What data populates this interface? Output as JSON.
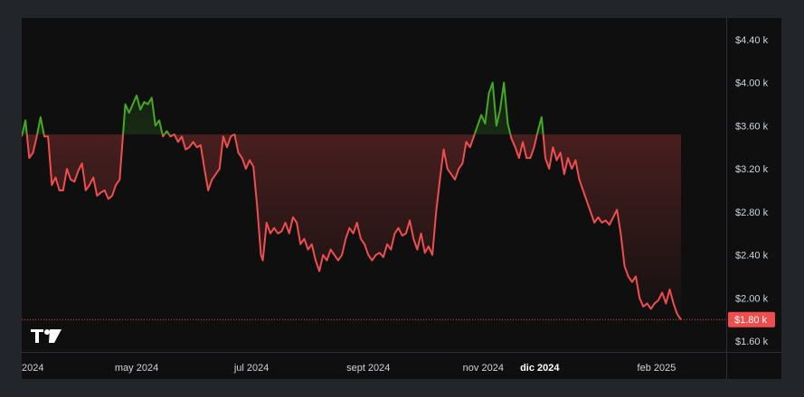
{
  "colors": {
    "background": "#0f0f0f",
    "outer": "#22262a",
    "above_baseline": "#44aa22",
    "below_baseline": "#f04e4e",
    "text": "#d1d4dc",
    "axis_line": "#2a2e39"
  },
  "logo": {
    "icon": "tradingview-logo-icon",
    "text": "TV"
  },
  "chart_data": {
    "type": "line",
    "style": "baseline",
    "y_unit": "USD",
    "ylim": [
      1.5,
      4.6
    ],
    "baseline_value": 3.52,
    "current_price": 1.8,
    "current_price_label": "$1.80 k",
    "grid": false,
    "y_ticks": [
      {
        "value": 4.4,
        "label": "$4.40 k"
      },
      {
        "value": 4.0,
        "label": "$4.00 k"
      },
      {
        "value": 3.6,
        "label": "$3.60 k"
      },
      {
        "value": 3.2,
        "label": "$3.20 k"
      },
      {
        "value": 2.8,
        "label": "$2.80 k"
      },
      {
        "value": 2.4,
        "label": "$2.40 k"
      },
      {
        "value": 2.0,
        "label": "$2.00 k"
      },
      {
        "value": 1.6,
        "label": "$1.60 k"
      }
    ],
    "x_ticks": [
      {
        "date": "2024-03-01",
        "label": "2024",
        "bold": false
      },
      {
        "date": "2024-05-01",
        "label": "may 2024",
        "bold": false
      },
      {
        "date": "2024-07-01",
        "label": "jul 2024",
        "bold": false
      },
      {
        "date": "2024-09-01",
        "label": "sept 2024",
        "bold": false
      },
      {
        "date": "2024-11-01",
        "label": "nov 2024",
        "bold": false
      },
      {
        "date": "2024-12-01",
        "label": "dic 2024",
        "bold": true
      },
      {
        "date": "2025-02-01",
        "label": "feb 2025",
        "bold": false
      }
    ],
    "x_start": "2024-03-01",
    "x_end": "2025-03-10",
    "points": [
      [
        "2024-03-01",
        3.5
      ],
      [
        "2024-03-03",
        3.65
      ],
      [
        "2024-03-05",
        3.3
      ],
      [
        "2024-03-07",
        3.35
      ],
      [
        "2024-03-09",
        3.5
      ],
      [
        "2024-03-11",
        3.68
      ],
      [
        "2024-03-13",
        3.5
      ],
      [
        "2024-03-15",
        3.5
      ],
      [
        "2024-03-17",
        3.05
      ],
      [
        "2024-03-19",
        3.12
      ],
      [
        "2024-03-21",
        3.0
      ],
      [
        "2024-03-23",
        3.0
      ],
      [
        "2024-03-25",
        3.2
      ],
      [
        "2024-03-27",
        3.1
      ],
      [
        "2024-03-29",
        3.08
      ],
      [
        "2024-03-31",
        3.18
      ],
      [
        "2024-04-02",
        3.25
      ],
      [
        "2024-04-04",
        3.0
      ],
      [
        "2024-04-06",
        3.05
      ],
      [
        "2024-04-08",
        3.12
      ],
      [
        "2024-04-10",
        2.95
      ],
      [
        "2024-04-12",
        2.98
      ],
      [
        "2024-04-14",
        3.0
      ],
      [
        "2024-04-16",
        2.92
      ],
      [
        "2024-04-18",
        2.95
      ],
      [
        "2024-04-20",
        3.05
      ],
      [
        "2024-04-22",
        3.1
      ],
      [
        "2024-04-25",
        3.8
      ],
      [
        "2024-04-27",
        3.72
      ],
      [
        "2024-04-29",
        3.8
      ],
      [
        "2024-05-01",
        3.88
      ],
      [
        "2024-05-03",
        3.75
      ],
      [
        "2024-05-05",
        3.82
      ],
      [
        "2024-05-07",
        3.8
      ],
      [
        "2024-05-09",
        3.86
      ],
      [
        "2024-05-11",
        3.6
      ],
      [
        "2024-05-13",
        3.65
      ],
      [
        "2024-05-15",
        3.5
      ],
      [
        "2024-05-17",
        3.55
      ],
      [
        "2024-05-19",
        3.5
      ],
      [
        "2024-05-21",
        3.52
      ],
      [
        "2024-05-23",
        3.45
      ],
      [
        "2024-05-25",
        3.5
      ],
      [
        "2024-05-27",
        3.38
      ],
      [
        "2024-05-29",
        3.4
      ],
      [
        "2024-05-31",
        3.45
      ],
      [
        "2024-06-02",
        3.4
      ],
      [
        "2024-06-04",
        3.42
      ],
      [
        "2024-06-06",
        3.2
      ],
      [
        "2024-06-08",
        3.0
      ],
      [
        "2024-06-10",
        3.1
      ],
      [
        "2024-06-12",
        3.15
      ],
      [
        "2024-06-14",
        3.2
      ],
      [
        "2024-06-16",
        3.5
      ],
      [
        "2024-06-18",
        3.4
      ],
      [
        "2024-06-20",
        3.5
      ],
      [
        "2024-06-22",
        3.52
      ],
      [
        "2024-06-24",
        3.35
      ],
      [
        "2024-06-26",
        3.3
      ],
      [
        "2024-06-28",
        3.2
      ],
      [
        "2024-06-30",
        3.28
      ],
      [
        "2024-07-02",
        3.22
      ],
      [
        "2024-07-04",
        2.85
      ],
      [
        "2024-07-06",
        2.4
      ],
      [
        "2024-07-07",
        2.35
      ],
      [
        "2024-07-09",
        2.7
      ],
      [
        "2024-07-11",
        2.6
      ],
      [
        "2024-07-13",
        2.65
      ],
      [
        "2024-07-15",
        2.6
      ],
      [
        "2024-07-17",
        2.62
      ],
      [
        "2024-07-19",
        2.7
      ],
      [
        "2024-07-21",
        2.6
      ],
      [
        "2024-07-23",
        2.75
      ],
      [
        "2024-07-25",
        2.7
      ],
      [
        "2024-07-27",
        2.5
      ],
      [
        "2024-07-29",
        2.55
      ],
      [
        "2024-07-31",
        2.45
      ],
      [
        "2024-08-02",
        2.5
      ],
      [
        "2024-08-04",
        2.35
      ],
      [
        "2024-08-06",
        2.25
      ],
      [
        "2024-08-08",
        2.4
      ],
      [
        "2024-08-10",
        2.35
      ],
      [
        "2024-08-12",
        2.45
      ],
      [
        "2024-08-14",
        2.4
      ],
      [
        "2024-08-16",
        2.35
      ],
      [
        "2024-08-18",
        2.4
      ],
      [
        "2024-08-20",
        2.55
      ],
      [
        "2024-08-22",
        2.65
      ],
      [
        "2024-08-24",
        2.6
      ],
      [
        "2024-08-26",
        2.7
      ],
      [
        "2024-08-28",
        2.55
      ],
      [
        "2024-08-30",
        2.5
      ],
      [
        "2024-09-01",
        2.4
      ],
      [
        "2024-09-03",
        2.35
      ],
      [
        "2024-09-05",
        2.4
      ],
      [
        "2024-09-07",
        2.42
      ],
      [
        "2024-09-09",
        2.38
      ],
      [
        "2024-09-11",
        2.5
      ],
      [
        "2024-09-13",
        2.45
      ],
      [
        "2024-09-15",
        2.6
      ],
      [
        "2024-09-17",
        2.65
      ],
      [
        "2024-09-19",
        2.58
      ],
      [
        "2024-09-21",
        2.6
      ],
      [
        "2024-09-23",
        2.72
      ],
      [
        "2024-09-25",
        2.55
      ],
      [
        "2024-09-27",
        2.45
      ],
      [
        "2024-09-29",
        2.6
      ],
      [
        "2024-10-01",
        2.42
      ],
      [
        "2024-10-03",
        2.48
      ],
      [
        "2024-10-05",
        2.4
      ],
      [
        "2024-10-07",
        2.8
      ],
      [
        "2024-10-09",
        3.1
      ],
      [
        "2024-10-11",
        3.38
      ],
      [
        "2024-10-13",
        3.2
      ],
      [
        "2024-10-15",
        3.15
      ],
      [
        "2024-10-17",
        3.1
      ],
      [
        "2024-10-19",
        3.2
      ],
      [
        "2024-10-21",
        3.25
      ],
      [
        "2024-10-23",
        3.45
      ],
      [
        "2024-10-25",
        3.4
      ],
      [
        "2024-10-27",
        3.5
      ],
      [
        "2024-10-29",
        3.6
      ],
      [
        "2024-10-31",
        3.7
      ],
      [
        "2024-11-02",
        3.62
      ],
      [
        "2024-11-04",
        3.9
      ],
      [
        "2024-11-06",
        4.0
      ],
      [
        "2024-11-08",
        3.6
      ],
      [
        "2024-11-10",
        3.75
      ],
      [
        "2024-11-12",
        4.0
      ],
      [
        "2024-11-14",
        3.62
      ],
      [
        "2024-11-16",
        3.48
      ],
      [
        "2024-11-18",
        3.4
      ],
      [
        "2024-11-20",
        3.3
      ],
      [
        "2024-11-22",
        3.45
      ],
      [
        "2024-11-24",
        3.3
      ],
      [
        "2024-11-26",
        3.3
      ],
      [
        "2024-11-28",
        3.4
      ],
      [
        "2024-11-30",
        3.55
      ],
      [
        "2024-12-02",
        3.68
      ],
      [
        "2024-12-04",
        3.3
      ],
      [
        "2024-12-06",
        3.2
      ],
      [
        "2024-12-08",
        3.4
      ],
      [
        "2024-12-10",
        3.28
      ],
      [
        "2024-12-12",
        3.35
      ],
      [
        "2024-12-14",
        3.15
      ],
      [
        "2024-12-16",
        3.3
      ],
      [
        "2024-12-18",
        3.2
      ],
      [
        "2024-12-20",
        3.28
      ],
      [
        "2024-12-22",
        3.1
      ],
      [
        "2024-12-24",
        3.0
      ],
      [
        "2024-12-26",
        2.9
      ],
      [
        "2024-12-28",
        2.8
      ],
      [
        "2024-12-30",
        2.7
      ],
      [
        "2025-01-01",
        2.75
      ],
      [
        "2025-01-03",
        2.7
      ],
      [
        "2025-01-05",
        2.72
      ],
      [
        "2025-01-07",
        2.68
      ],
      [
        "2025-01-09",
        2.75
      ],
      [
        "2025-01-11",
        2.82
      ],
      [
        "2025-01-13",
        2.6
      ],
      [
        "2025-01-15",
        2.3
      ],
      [
        "2025-01-17",
        2.2
      ],
      [
        "2025-01-19",
        2.15
      ],
      [
        "2025-01-21",
        2.2
      ],
      [
        "2025-01-23",
        2.0
      ],
      [
        "2025-01-25",
        1.92
      ],
      [
        "2025-01-27",
        1.95
      ],
      [
        "2025-01-29",
        1.9
      ],
      [
        "2025-01-31",
        1.95
      ],
      [
        "2025-02-02",
        1.98
      ],
      [
        "2025-02-04",
        2.05
      ],
      [
        "2025-02-06",
        1.95
      ],
      [
        "2025-02-08",
        2.08
      ],
      [
        "2025-02-10",
        1.95
      ],
      [
        "2025-02-12",
        1.85
      ],
      [
        "2025-02-14",
        1.8
      ]
    ]
  }
}
